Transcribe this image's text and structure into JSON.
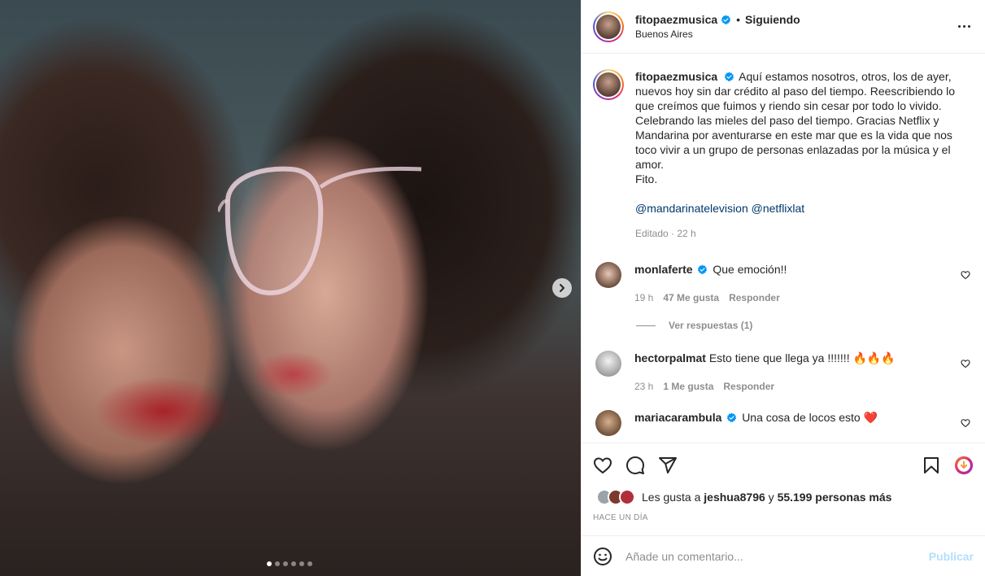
{
  "post": {
    "username": "fitopaezmusica",
    "follow_label": "Siguiendo",
    "separator": "•",
    "location": "Buenos Aires",
    "caption": "Aquí estamos nosotros, otros, los de ayer, nuevos hoy sin dar crédito al paso del tiempo. Reescribiendo lo que creímos que fuimos y riendo sin cesar por todo lo vivido. Celebrando las mieles del paso del tiempo. Gracias Netflix y Mandarina por aventurarse en este mar que es la vida que nos toco vivir a un grupo de personas enlazadas por la música y el amor.",
    "signature": "Fito.",
    "mentions": [
      "@mandarinatelevision",
      "@netflixlat"
    ],
    "meta": "Editado · 22 h"
  },
  "comments": [
    {
      "user": "monlaferte",
      "verified": true,
      "text": "Que emoción!!",
      "time": "19 h",
      "likes": "47 Me gusta",
      "reply": "Responder",
      "replies": "Ver respuestas (1)"
    },
    {
      "user": "hectorpalmat",
      "verified": false,
      "text": "Esto tiene que llega ya !!!!!!! 🔥🔥🔥",
      "time": "23 h",
      "likes": "1 Me gusta",
      "reply": "Responder"
    },
    {
      "user": "mariacarambula",
      "verified": true,
      "text": "Una cosa de locos esto ❤️"
    }
  ],
  "likes": {
    "prefix": "Les gusta a",
    "user": "jeshua8796",
    "connector": "y",
    "others": "55.199 personas más"
  },
  "timestamp": "HACE UN DÍA",
  "compose": {
    "placeholder": "Añade un comentario...",
    "publish": "Publicar"
  },
  "carousel": {
    "count": 6,
    "active": 1
  },
  "colors": {
    "accent": "#0095f6",
    "verified": "#0095f6",
    "mention": "#00376b",
    "muted": "#8e8e8e"
  },
  "icons": [
    "heart-icon",
    "comment-icon",
    "share-icon",
    "bookmark-icon",
    "download-icon",
    "emoji-icon",
    "more-icon",
    "chevron-right-icon"
  ]
}
